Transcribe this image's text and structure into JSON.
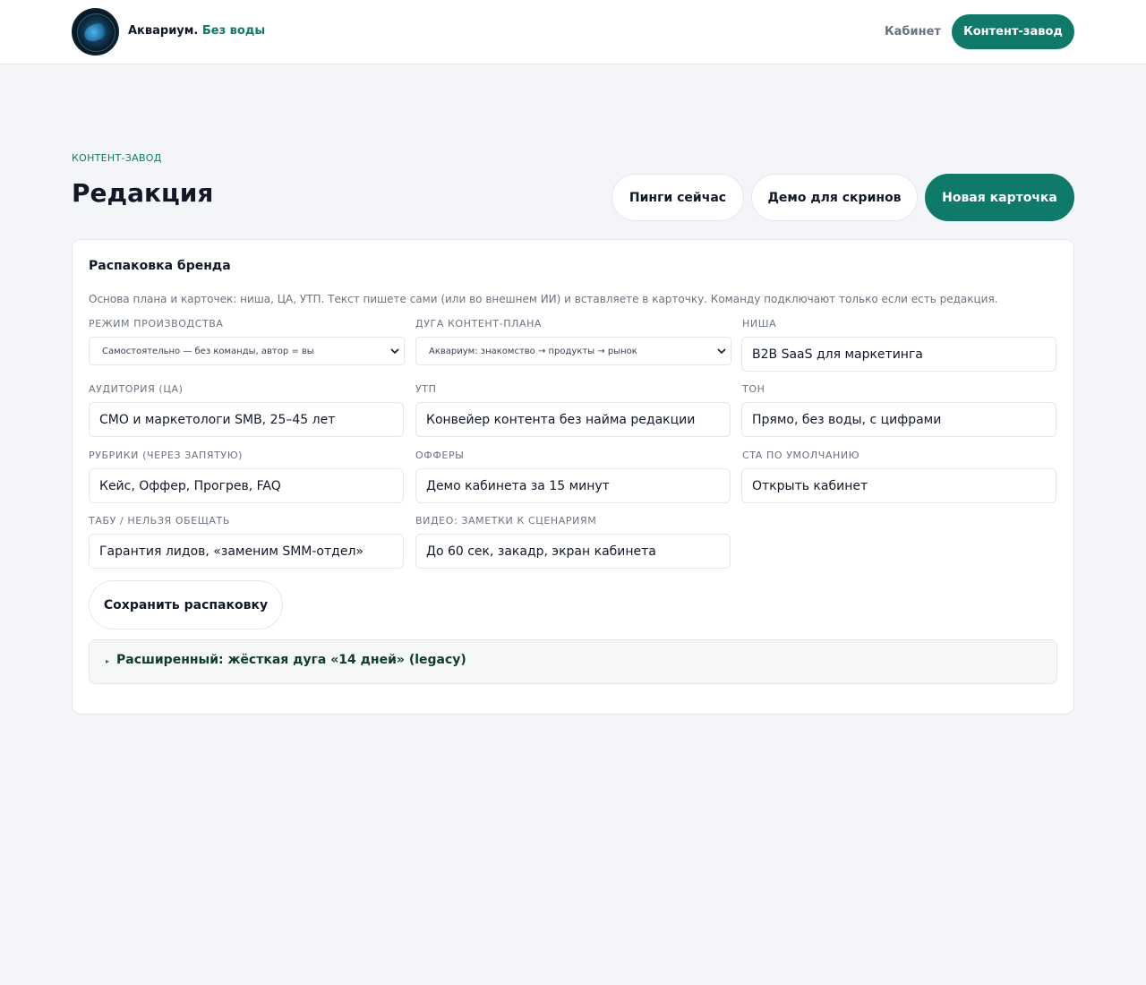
{
  "header": {
    "brand_name": "Аквариум.",
    "brand_accent": "Без воды",
    "nav_link": "Кабинет",
    "nav_button": "Контент-завод"
  },
  "page": {
    "eyebrow": "КОНТЕНТ-ЗАВОД",
    "title": "Редакция",
    "actions": {
      "pings": "Пинги сейчас",
      "demo": "Демо для скринов",
      "new_card": "Новая карточка"
    }
  },
  "card": {
    "title": "Распаковка бренда",
    "description": "Основа плана и карточек: ниша, ЦА, УТП. Текст пишете сами (или во внешнем ИИ) и вставляете в карточку. Команду подключают только если есть редакция.",
    "fields": {
      "mode": {
        "label": "РЕЖИМ ПРОИЗВОДСТВА",
        "value": "Самостоятельно — без команды, автор = вы"
      },
      "arc": {
        "label": "ДУГА КОНТЕНТ-ПЛАНА",
        "value": "Аквариум: знакомство → продукты → рынок"
      },
      "niche": {
        "label": "НИША",
        "value": "B2B SaaS для маркетинга"
      },
      "audience": {
        "label": "АУДИТОРИЯ (ЦА)",
        "value": "CMO и маркетологи SMB, 25–45 лет"
      },
      "usp": {
        "label": "УТП",
        "value": "Конвейер контента без найма редакции"
      },
      "tone": {
        "label": "ТОН",
        "value": "Прямо, без воды, с цифрами"
      },
      "rubrics": {
        "label": "РУБРИКИ (ЧЕРЕЗ ЗАПЯТУЮ)",
        "value": "Кейс, Оффер, Прогрев, FAQ"
      },
      "offers": {
        "label": "ОФФЕРЫ",
        "value": "Демо кабинета за 15 минут"
      },
      "cta": {
        "label": "CTA ПО УМОЛЧАНИЮ",
        "value": "Открыть кабинет"
      },
      "taboo": {
        "label": "ТАБУ / НЕЛЬЗЯ ОБЕЩАТЬ",
        "value": "Гарантия лидов, «заменим SMM-отдел»"
      },
      "video": {
        "label": "ВИДЕО: ЗАМЕТКИ К СЦЕНАРИЯМ",
        "value": "До 60 сек, закадр, экран кабинета"
      }
    },
    "save_button": "Сохранить распаковку",
    "advanced": "Расширенный: жёсткая дуга «14 дней» (legacy)"
  }
}
